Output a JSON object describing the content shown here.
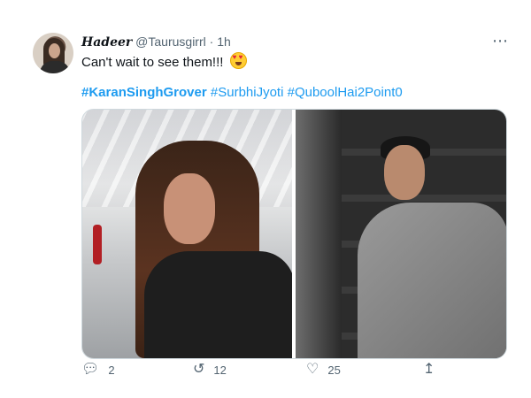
{
  "tweet": {
    "author_name": "Hadeer",
    "handle": "@Taurusgirrl",
    "time": "1h",
    "separator": "·",
    "text": "Can't wait to see them!!!",
    "emoji": "smiling-face-with-heart-eyes",
    "hashtags": [
      "#KaranSinghGrover",
      "#SurbhiJyoti",
      "#QuboolHai2Point0"
    ]
  },
  "actions": {
    "reply_count": "2",
    "retweet_count": "12",
    "like_count": "25",
    "reply_icon": "reply-icon",
    "retweet_icon": "retweet-icon",
    "like_icon": "heart-icon",
    "share_icon": "share-icon"
  },
  "colors": {
    "link": "#1d9bf0",
    "secondary_text": "#536471",
    "primary_text": "#0f1419"
  }
}
